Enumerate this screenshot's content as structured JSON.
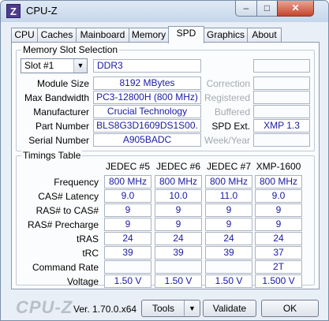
{
  "window": {
    "title": "CPU-Z",
    "icon_letter": "Z",
    "minimize_glyph": "–",
    "maximize_glyph": "□",
    "close_glyph": "✕"
  },
  "tabs": [
    "CPU",
    "Caches",
    "Mainboard",
    "Memory",
    "SPD",
    "Graphics",
    "About"
  ],
  "active_tab": "SPD",
  "memory_slot": {
    "group_title": "Memory Slot Selection",
    "slot_selected": "Slot #1",
    "memory_type": "DDR3",
    "labels": {
      "module_size": "Module Size",
      "max_bandwidth": "Max Bandwidth",
      "manufacturer": "Manufacturer",
      "part_number": "Part Number",
      "serial_number": "Serial Number",
      "correction": "Correction",
      "registered": "Registered",
      "buffered": "Buffered",
      "spd_ext": "SPD Ext.",
      "week_year": "Week/Year"
    },
    "values": {
      "module_size": "8192 MBytes",
      "max_bandwidth": "PC3-12800H (800 MHz)",
      "manufacturer": "Crucial Technology",
      "part_number": "BLS8G3D1609DS1S00.",
      "serial_number": "A905BADC",
      "spd_ext": "XMP 1.3"
    }
  },
  "timings": {
    "group_title": "Timings Table",
    "columns": [
      "JEDEC #5",
      "JEDEC #6",
      "JEDEC #7",
      "XMP-1600"
    ],
    "rows": [
      {
        "label": "Frequency",
        "values": [
          "800 MHz",
          "800 MHz",
          "800 MHz",
          "800 MHz"
        ]
      },
      {
        "label": "CAS# Latency",
        "values": [
          "9.0",
          "10.0",
          "11.0",
          "9.0"
        ]
      },
      {
        "label": "RAS# to CAS#",
        "values": [
          "9",
          "9",
          "9",
          "9"
        ]
      },
      {
        "label": "RAS# Precharge",
        "values": [
          "9",
          "9",
          "9",
          "9"
        ]
      },
      {
        "label": "tRAS",
        "values": [
          "24",
          "24",
          "24",
          "24"
        ]
      },
      {
        "label": "tRC",
        "values": [
          "39",
          "39",
          "39",
          "37"
        ]
      },
      {
        "label": "Command Rate",
        "values": [
          "",
          "",
          "",
          "2T"
        ]
      },
      {
        "label": "Voltage",
        "values": [
          "1.50 V",
          "1.50 V",
          "1.50 V",
          "1.500 V"
        ]
      }
    ]
  },
  "footer": {
    "logo": "CPU-Z",
    "version": "Ver. 1.70.0.x64",
    "tools_label": "Tools",
    "validate_label": "Validate",
    "ok_label": "OK"
  }
}
